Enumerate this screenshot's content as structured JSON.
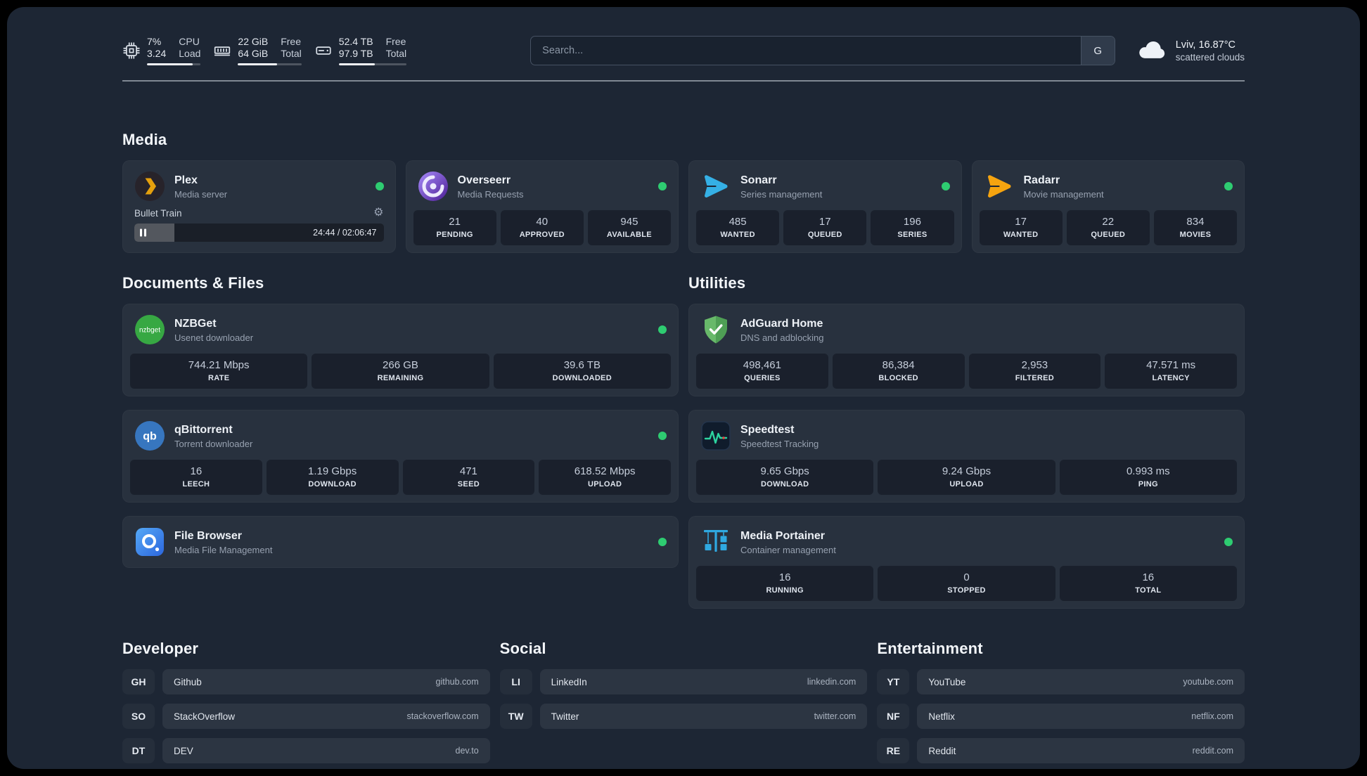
{
  "colors": {
    "page_bg": "#1d2634",
    "frame_bg": "#000000",
    "card_bg": "rgba(255,255,255,0.05)",
    "tile_bg": "rgba(8,13,22,0.45)",
    "status_online": "#2ecc71",
    "text_primary": "#eef2f7",
    "text_secondary": "#97a1b0",
    "plex_brand": "#e5a00d"
  },
  "icons": {
    "cpu": "chip-icon",
    "memory": "ram-module-icon",
    "disk": "hard-drive-icon",
    "weather": "cloud-icon",
    "settings": "gear-icon (unicode ⚙)",
    "pause": "pause-bars-icon",
    "status": "green-dot"
  },
  "topbar": {
    "cpu": {
      "value_top": "7%",
      "value_bottom": "3.24",
      "label_top": "CPU",
      "label_bottom": "Load",
      "progress": 85
    },
    "memory": {
      "value_top": "22 GiB",
      "value_bottom": "64 GiB",
      "label_top": "Free",
      "label_bottom": "Total",
      "progress": 62
    },
    "disk": {
      "value_top": "52.4 TB",
      "value_bottom": "97.9 TB",
      "label_top": "Free",
      "label_bottom": "Total",
      "progress": 53
    },
    "search": {
      "placeholder": "Search...",
      "provider": "G"
    },
    "weather": {
      "location": "Lviv, 16.87°C",
      "condition": "scattered clouds"
    }
  },
  "sections": {
    "media": {
      "title": "Media"
    },
    "documents": {
      "title": "Documents & Files"
    },
    "utilities": {
      "title": "Utilities"
    },
    "developer": {
      "title": "Developer"
    },
    "social": {
      "title": "Social"
    },
    "entertainment": {
      "title": "Entertainment"
    }
  },
  "services": {
    "plex": {
      "name": "Plex",
      "desc": "Media server",
      "status": "online",
      "player": {
        "track": "Bullet Train",
        "time": "24:44 / 02:06:47",
        "progress": 16
      }
    },
    "overseerr": {
      "name": "Overseerr",
      "desc": "Media Requests",
      "status": "online",
      "stats": [
        {
          "value": "21",
          "label": "PENDING"
        },
        {
          "value": "40",
          "label": "APPROVED"
        },
        {
          "value": "945",
          "label": "AVAILABLE"
        }
      ]
    },
    "sonarr": {
      "name": "Sonarr",
      "desc": "Series management",
      "status": "online",
      "stats": [
        {
          "value": "485",
          "label": "WANTED"
        },
        {
          "value": "17",
          "label": "QUEUED"
        },
        {
          "value": "196",
          "label": "SERIES"
        }
      ]
    },
    "radarr": {
      "name": "Radarr",
      "desc": "Movie management",
      "status": "online",
      "stats": [
        {
          "value": "17",
          "label": "WANTED"
        },
        {
          "value": "22",
          "label": "QUEUED"
        },
        {
          "value": "834",
          "label": "MOVIES"
        }
      ]
    },
    "nzbget": {
      "name": "NZBGet",
      "desc": "Usenet downloader",
      "status": "online",
      "stats": [
        {
          "value": "744.21 Mbps",
          "label": "RATE"
        },
        {
          "value": "266 GB",
          "label": "REMAINING"
        },
        {
          "value": "39.6 TB",
          "label": "DOWNLOADED"
        }
      ]
    },
    "qbittorrent": {
      "name": "qBittorrent",
      "desc": "Torrent downloader",
      "status": "online",
      "stats": [
        {
          "value": "16",
          "label": "LEECH"
        },
        {
          "value": "1.19 Gbps",
          "label": "DOWNLOAD"
        },
        {
          "value": "471",
          "label": "SEED"
        },
        {
          "value": "618.52 Mbps",
          "label": "UPLOAD"
        }
      ]
    },
    "filebrowser": {
      "name": "File Browser",
      "desc": "Media File Management",
      "status": "online"
    },
    "adguard": {
      "name": "AdGuard Home",
      "desc": "DNS and adblocking",
      "stats": [
        {
          "value": "498,461",
          "label": "QUERIES"
        },
        {
          "value": "86,384",
          "label": "BLOCKED"
        },
        {
          "value": "2,953",
          "label": "FILTERED"
        },
        {
          "value": "47.571 ms",
          "label": "LATENCY"
        }
      ]
    },
    "speedtest": {
      "name": "Speedtest",
      "desc": "Speedtest Tracking",
      "stats": [
        {
          "value": "9.65 Gbps",
          "label": "DOWNLOAD"
        },
        {
          "value": "9.24 Gbps",
          "label": "UPLOAD"
        },
        {
          "value": "0.993 ms",
          "label": "PING"
        }
      ]
    },
    "portainer": {
      "name": "Media Portainer",
      "desc": "Container management",
      "status": "online",
      "stats": [
        {
          "value": "16",
          "label": "RUNNING"
        },
        {
          "value": "0",
          "label": "STOPPED"
        },
        {
          "value": "16",
          "label": "TOTAL"
        }
      ]
    }
  },
  "bookmarks": {
    "developer": [
      {
        "abbr": "GH",
        "name": "Github",
        "domain": "github.com"
      },
      {
        "abbr": "SO",
        "name": "StackOverflow",
        "domain": "stackoverflow.com"
      },
      {
        "abbr": "DT",
        "name": "DEV",
        "domain": "dev.to"
      }
    ],
    "social": [
      {
        "abbr": "LI",
        "name": "LinkedIn",
        "domain": "linkedin.com"
      },
      {
        "abbr": "TW",
        "name": "Twitter",
        "domain": "twitter.com"
      }
    ],
    "entertainment": [
      {
        "abbr": "YT",
        "name": "YouTube",
        "domain": "youtube.com"
      },
      {
        "abbr": "NF",
        "name": "Netflix",
        "domain": "netflix.com"
      },
      {
        "abbr": "RE",
        "name": "Reddit",
        "domain": "reddit.com"
      }
    ]
  }
}
